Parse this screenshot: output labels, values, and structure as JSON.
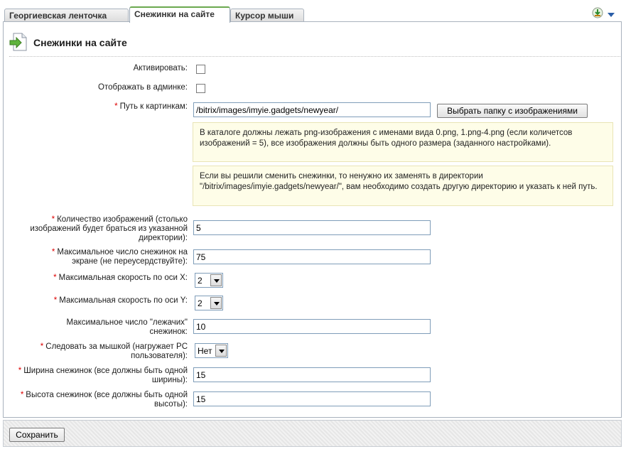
{
  "tabs": [
    {
      "label": "Георгиевская ленточка"
    },
    {
      "label": "Снежинки на сайте"
    },
    {
      "label": "Курсор мыши"
    }
  ],
  "toolbar": {
    "icons": [
      "download-icon",
      "dropdown-arrow-icon"
    ]
  },
  "title": "Снежинки на сайте",
  "form": {
    "activate_label": "Активировать:",
    "show_admin_label": "Отображать в админке:",
    "path_label": "Путь к картинкам:",
    "path_value": "/bitrix/images/imyie.gadgets/newyear/",
    "choose_folder_button": "Выбрать папку с изображениями",
    "note1": "В каталоге должны лежать png-изображения с именами вида 0.png, 1.png-4.png (если количетсов изображений = 5), все изображения должны быть одного размера (заданного настройками).",
    "note2": "Если вы решили сменить снежинки, то ненужно их заменять в директории \"/bitrix/images/imyie.gadgets/newyear/\", вам необходимо создать другую директорию и указать к ней путь.",
    "count_label": "Количество изображений (столько изображений будет браться из указанной директории):",
    "count_value": "5",
    "max_flakes_label": "Максимальное число снежинок на экране (не переусердствуйте):",
    "max_flakes_value": "75",
    "speed_x_label": "Максимальная скорость по оси X:",
    "speed_x_value": "2",
    "speed_y_label": "Максимальная скорость по оси Y:",
    "speed_y_value": "2",
    "lying_label": "Максимальное число \"лежачих\" снежинок:",
    "lying_value": "10",
    "follow_mouse_label": "Следовать за мышкой (нагружает PC пользователя):",
    "follow_mouse_value": "Нет",
    "width_label": "Ширина снежинок (все должны быть одной ширины):",
    "width_value": "15",
    "height_label": "Высота снежинок (все должны быть одной высоты):",
    "height_value": "15"
  },
  "footer": {
    "save_button": "Сохранить"
  }
}
